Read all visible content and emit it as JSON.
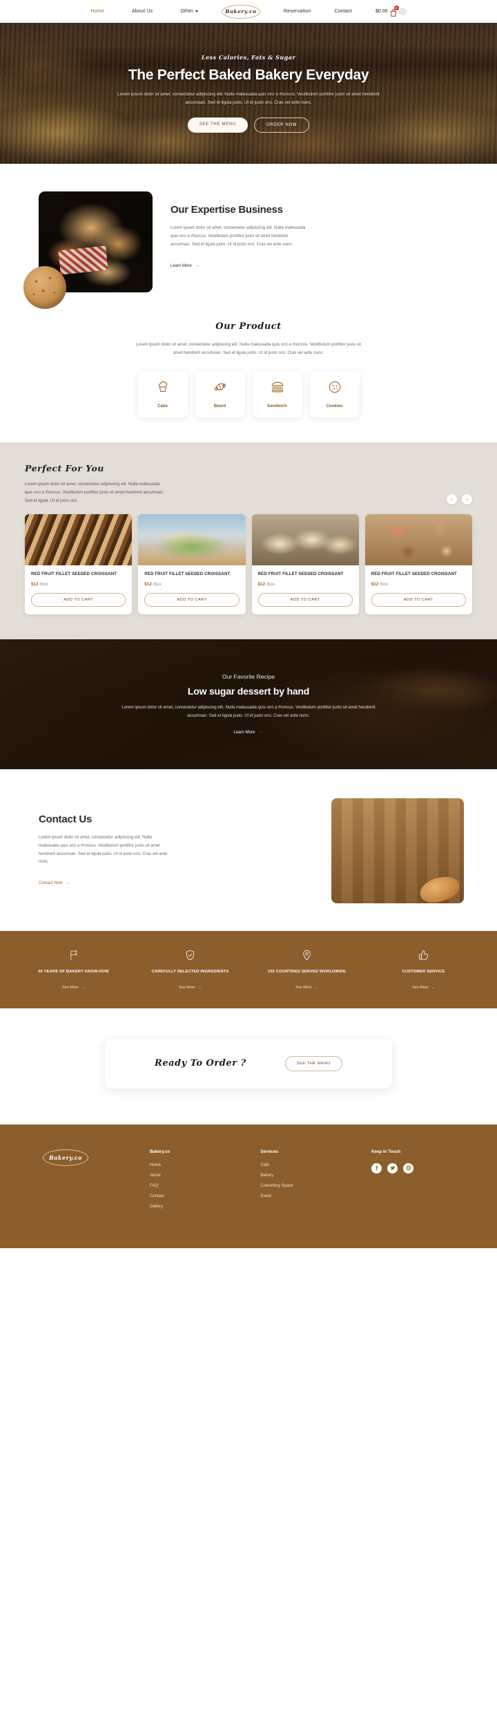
{
  "brand": {
    "name": "Bakery.co",
    "accent": "#a4692c",
    "brown": "#8b5e2b",
    "beige": "#e2ddd5"
  },
  "nav": {
    "left": [
      {
        "label": "Home",
        "active": true
      },
      {
        "label": "About Us",
        "active": false
      },
      {
        "label": "Other",
        "active": false,
        "caret": true
      }
    ],
    "logo": "Bakery.co",
    "right": [
      {
        "label": "Reservation"
      },
      {
        "label": "Contact"
      }
    ],
    "cart_price": "$0.00",
    "cart_count": "0",
    "cart_icon": "shopping-bag-icon",
    "avatar_icon": "user-avatar-icon"
  },
  "hero": {
    "kicker": "Less Calories, Fats & Sugar",
    "title": "The Perfect Baked Bakery Everyday",
    "text": "Lorem ipsum dolor sit amet, consectetur adipiscing elit. Nulla malesuada quis orci a rhoncus. Vestibulum porttitor justo sit amet hendrerit accumsan. Sed et ligula justo. Ut id justo orci. Cras vel ante nunc.",
    "primary_btn": "SEE THE MENU",
    "secondary_btn": "ORDER NOW"
  },
  "expertise": {
    "title": "Our Expertise Business",
    "text": "Lorem ipsum dolor sit amet, consectetur adipiscing elit. Nulla malesuada quis orci a rhoncus. Vestibulum porttitor justo sit amet hendrerit accumsan. Sed et ligula justo. Ut id justo orci. Cras vel ante nunc.",
    "link": "Learn More",
    "arrow": "→"
  },
  "our_product": {
    "title": "Our Product",
    "text": "Lorem ipsum dolor sit amet, consectetur adipiscing elit. Nulla malesuada quis orci a rhoncus. Vestibulum porttitor justo sit amet hendrerit accumsan. Sed et ligula justo. Ut id justo orci. Cras vel ante nunc.",
    "categories": [
      {
        "label": "Cake",
        "icon": "cupcake-icon"
      },
      {
        "label": "Beard",
        "icon": "croissant-icon"
      },
      {
        "label": "Sandwich",
        "icon": "burger-icon"
      },
      {
        "label": "Cookies",
        "icon": "cookie-icon"
      }
    ]
  },
  "perfect": {
    "title": "Perfect For You",
    "text": "Lorem ipsum dolor sit amet, consectetur adipiscing elit, Nulla malesuada quis orci a rhoncus. Vestibulum porttitor justo sit amet hendrerit accumsan. Sed et ligula. Ut id justo orci.",
    "prev": "←",
    "next": "→",
    "products": [
      {
        "name": "RED FRUIT FILLET SEEDED CROISSANT",
        "price": "$12",
        "unit": "/box",
        "cta": "ADD TO CART"
      },
      {
        "name": "RED FRUIT FILLET SEEDED CROISSANT",
        "price": "$12",
        "unit": "/box",
        "cta": "ADD TO CART"
      },
      {
        "name": "RED FRUIT FILLET SEEDED CROISSANT",
        "price": "$12",
        "unit": "/box",
        "cta": "ADD TO CART"
      },
      {
        "name": "RED FRUIT FILLET SEEDED CROISSANT",
        "price": "$12",
        "unit": "/box",
        "cta": "ADD TO CART"
      }
    ]
  },
  "recipe": {
    "kicker": "Our Favorite Recipe",
    "title": "Low sugar dessert by hand",
    "text": "Lorem ipsum dolor sit amet, consectetur adipiscing elit. Nulla malesuada quis orci a rhoncus. Vestibulum porttitor justo sit amet hendrerit accumsan. Sed et ligula justo. Ut id justo orci. Cras vel ante nunc.",
    "link": "Learn More",
    "arrow": "→"
  },
  "contact": {
    "title": "Contact Us",
    "text": "Lorem ipsum dolor sit amet, consectetur adipiscing elit. Nulla malesuada quis orci a rhoncus. Vestibulum porttitor justo sit amet hendrerit accumsan. Sed et ligula justo. Ut id justo orci. Cras vel ante nunc.",
    "link": "Contact Now",
    "arrow": "→"
  },
  "features": [
    {
      "icon": "flag-icon",
      "title": "40 YEARS OF BAKERY KNOW-HOW",
      "more": "See More",
      "arrow": "→"
    },
    {
      "icon": "shield-check-icon",
      "title": "CAREFULLY SELECTED INGREDIENTS",
      "more": "See More",
      "arrow": "→"
    },
    {
      "icon": "location-pin-icon",
      "title": "150 COUNTRIES SERVED WORLDWIDE",
      "more": "See More",
      "arrow": "→"
    },
    {
      "icon": "thumbs-up-icon",
      "title": "CUSTOMER SERVICE",
      "more": "See More",
      "arrow": "→"
    }
  ],
  "cta": {
    "title": "Ready To Order ?",
    "button": "SEE THE MENU"
  },
  "footer": {
    "logo": "Bakery.co",
    "columns": [
      {
        "head": "Bakery.co",
        "links": [
          "Home",
          "About",
          "FAQ",
          "Contact",
          "Gallery"
        ]
      },
      {
        "head": "Services",
        "links": [
          "Cafe",
          "Bakery",
          "Coworking Space",
          "Event"
        ]
      }
    ],
    "social_head": "Keep In Touch",
    "socials": [
      {
        "icon": "facebook-icon",
        "glyph": "f"
      },
      {
        "icon": "twitter-icon",
        "glyph": "t"
      },
      {
        "icon": "instagram-icon",
        "glyph": "o"
      }
    ]
  }
}
